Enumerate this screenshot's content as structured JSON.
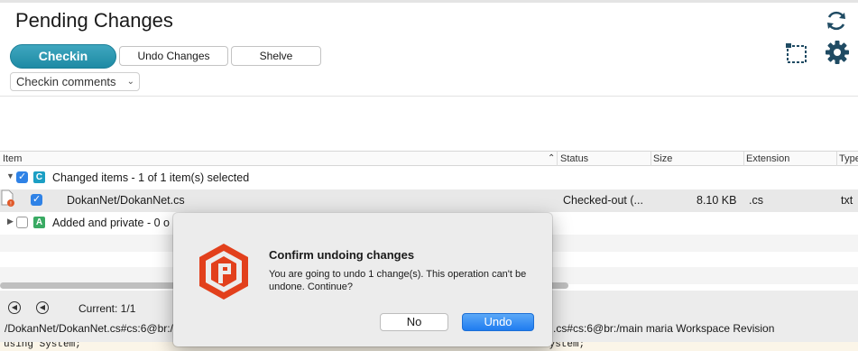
{
  "header": {
    "title": "Pending Changes"
  },
  "toolbar": {
    "checkin_label": "Checkin",
    "undo_label": "Undo Changes",
    "shelve_label": "Shelve",
    "comments_value": "Checkin comments"
  },
  "icons": {
    "refresh": "refresh-icon",
    "select": "selection-icon",
    "settings": "gear-icon"
  },
  "columns": {
    "item": "Item",
    "status": "Status",
    "size": "Size",
    "extension": "Extension",
    "type": "Type"
  },
  "tree": {
    "group_changed": {
      "badge": "C",
      "label": "Changed items - 1 of 1 item(s) selected",
      "badge_color": "#1c9fc4"
    },
    "file": {
      "name": "DokanNet/DokanNet.cs",
      "status": "Checked-out (...",
      "size": "8.10 KB",
      "extension": ".cs",
      "type": "txt"
    },
    "group_added": {
      "badge": "A",
      "label": "Added and private - 0 o",
      "badge_color": "#3aaa63"
    }
  },
  "nav": {
    "current": "Current: 1/1"
  },
  "paths": {
    "left": "/DokanNet/DokanNet.cs#cs:6@br:/",
    "right": ".cs#cs:6@br:/main maria Workspace Revision"
  },
  "code": {
    "left": "using System;",
    "right": "System;"
  },
  "dialog": {
    "title": "Confirm undoing changes",
    "message": "You are going to undo 1 change(s). This operation can't be undone. Continue?",
    "no_label": "No",
    "undo_label": "Undo"
  },
  "colors": {
    "accent": "#1e8aa4",
    "selected_row": "#e8e8e8",
    "primary_button": "#1f7cf0"
  }
}
